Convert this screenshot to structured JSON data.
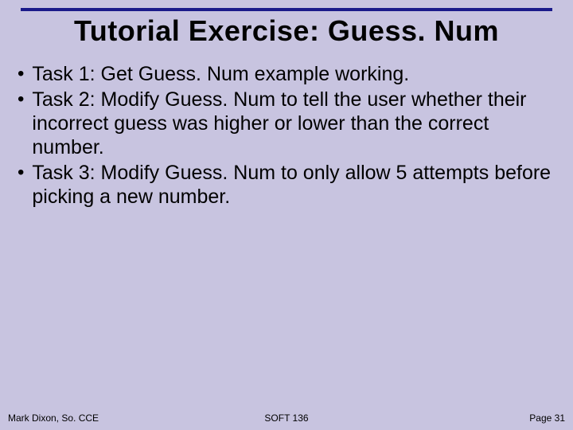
{
  "title": "Tutorial Exercise: Guess. Num",
  "bullets": [
    "Task 1: Get Guess. Num example working.",
    "Task 2: Modify Guess. Num to tell the user whether their incorrect guess was higher or lower than the correct number.",
    "Task 3: Modify Guess. Num to only allow 5 attempts before picking a new number."
  ],
  "footer": {
    "left": "Mark Dixon, So. CCE",
    "center": "SOFT 136",
    "right": "Page 31"
  }
}
